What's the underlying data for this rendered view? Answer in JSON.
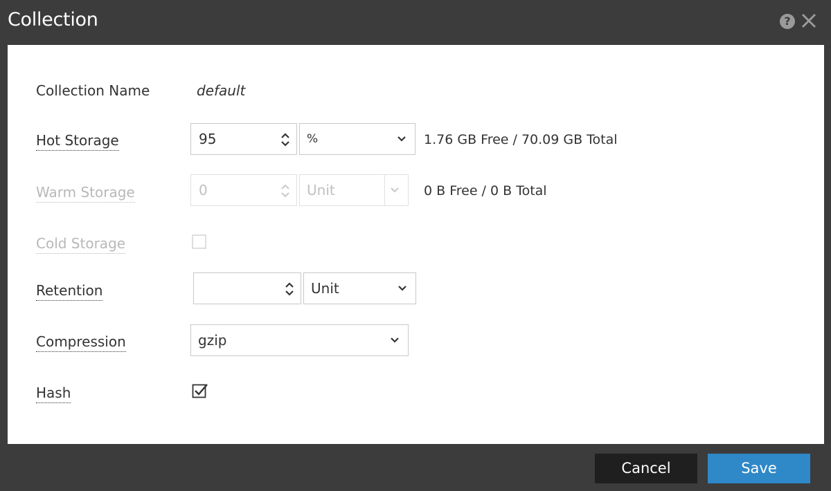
{
  "dialog": {
    "title": "Collection",
    "help_icon": "question-circle-icon",
    "close_icon": "close-icon"
  },
  "form": {
    "collection_name": {
      "label": "Collection Name",
      "value": "default"
    },
    "hot_storage": {
      "label": "Hot Storage",
      "value": "95",
      "unit": "%",
      "info": "1.76 GB Free / 70.09 GB Total"
    },
    "warm_storage": {
      "label": "Warm Storage",
      "value": "0",
      "unit": "Unit",
      "info": "0 B Free / 0 B Total",
      "disabled": true
    },
    "cold_storage": {
      "label": "Cold Storage",
      "checked": false,
      "disabled": true
    },
    "retention": {
      "label": "Retention",
      "value": "",
      "unit": "Unit"
    },
    "compression": {
      "label": "Compression",
      "value": "gzip"
    },
    "hash": {
      "label": "Hash",
      "checked": true
    }
  },
  "footer": {
    "cancel_label": "Cancel",
    "save_label": "Save"
  },
  "colors": {
    "chrome": "#3c3c3c",
    "primary": "#2f88c7",
    "cancel_bg": "#1f1f1f"
  }
}
